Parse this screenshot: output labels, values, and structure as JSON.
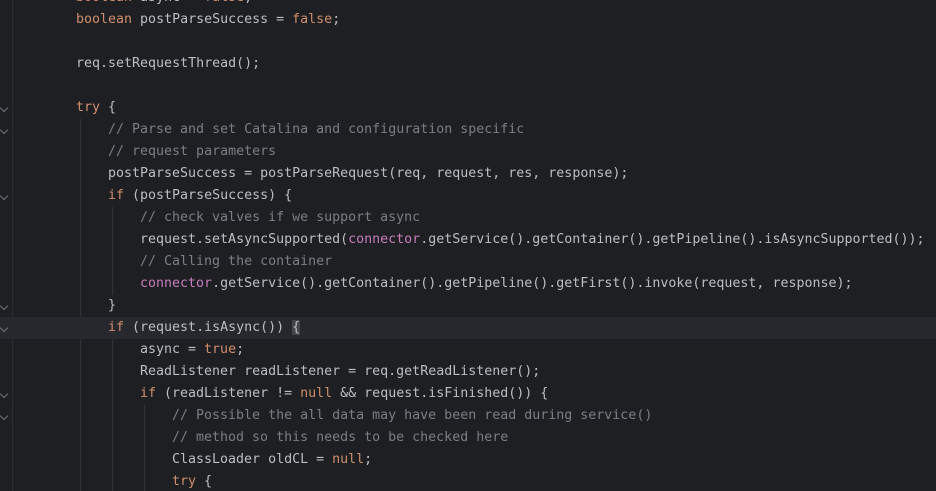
{
  "editor": {
    "lines": [
      {
        "indent": 0,
        "fold": false,
        "current": false,
        "tokens": [
          {
            "t": "kw",
            "v": "boolean"
          },
          {
            "t": "tx",
            "v": " async = "
          },
          {
            "t": "kw",
            "v": "false"
          },
          {
            "t": "tx",
            "v": ";"
          }
        ]
      },
      {
        "indent": 0,
        "fold": false,
        "current": false,
        "tokens": [
          {
            "t": "kw",
            "v": "boolean"
          },
          {
            "t": "tx",
            "v": " postParseSuccess = "
          },
          {
            "t": "kw",
            "v": "false"
          },
          {
            "t": "tx",
            "v": ";"
          }
        ]
      },
      {
        "indent": 0,
        "fold": false,
        "current": false,
        "tokens": []
      },
      {
        "indent": 0,
        "fold": false,
        "current": false,
        "tokens": [
          {
            "t": "tx",
            "v": "req.setRequestThread();"
          }
        ]
      },
      {
        "indent": 0,
        "fold": false,
        "current": false,
        "tokens": []
      },
      {
        "indent": 0,
        "fold": true,
        "current": false,
        "tokens": [
          {
            "t": "kw",
            "v": "try"
          },
          {
            "t": "tx",
            "v": " {"
          }
        ]
      },
      {
        "indent": 1,
        "fold": true,
        "current": false,
        "tokens": [
          {
            "t": "cm",
            "v": "// Parse and set Catalina and configuration specific"
          }
        ]
      },
      {
        "indent": 1,
        "fold": false,
        "current": false,
        "tokens": [
          {
            "t": "cm",
            "v": "// request parameters"
          }
        ]
      },
      {
        "indent": 1,
        "fold": false,
        "current": false,
        "tokens": [
          {
            "t": "tx",
            "v": "postParseSuccess = postParseRequest(req, request, res, response);"
          }
        ]
      },
      {
        "indent": 1,
        "fold": true,
        "current": false,
        "tokens": [
          {
            "t": "kw",
            "v": "if"
          },
          {
            "t": "tx",
            "v": " (postParseSuccess) {"
          }
        ]
      },
      {
        "indent": 2,
        "fold": false,
        "current": false,
        "tokens": [
          {
            "t": "cm",
            "v": "// check valves if we support async"
          }
        ]
      },
      {
        "indent": 2,
        "fold": false,
        "current": false,
        "tokens": [
          {
            "t": "tx",
            "v": "request.setAsyncSupported("
          },
          {
            "t": "fld",
            "v": "connector"
          },
          {
            "t": "tx",
            "v": ".getService().getContainer().getPipeline().isAsyncSupported());"
          }
        ]
      },
      {
        "indent": 2,
        "fold": false,
        "current": false,
        "tokens": [
          {
            "t": "cm",
            "v": "// Calling the container"
          }
        ]
      },
      {
        "indent": 2,
        "fold": false,
        "current": false,
        "tokens": [
          {
            "t": "fld",
            "v": "connector"
          },
          {
            "t": "tx",
            "v": ".getService().getContainer().getPipeline().getFirst().invoke(request, response);"
          }
        ]
      },
      {
        "indent": 1,
        "fold": true,
        "current": false,
        "tokens": [
          {
            "t": "tx",
            "v": "}"
          }
        ]
      },
      {
        "indent": 1,
        "fold": true,
        "current": true,
        "tokens": [
          {
            "t": "kw",
            "v": "if"
          },
          {
            "t": "tx",
            "v": " (request.isAsync()) "
          },
          {
            "t": "hl",
            "v": "{"
          }
        ]
      },
      {
        "indent": 2,
        "fold": false,
        "current": false,
        "tokens": [
          {
            "t": "tx",
            "v": "async = "
          },
          {
            "t": "kw",
            "v": "true"
          },
          {
            "t": "tx",
            "v": ";"
          }
        ]
      },
      {
        "indent": 2,
        "fold": false,
        "current": false,
        "tokens": [
          {
            "t": "tx",
            "v": "ReadListener readListener = req.getReadListener();"
          }
        ]
      },
      {
        "indent": 2,
        "fold": true,
        "current": false,
        "tokens": [
          {
            "t": "kw",
            "v": "if"
          },
          {
            "t": "tx",
            "v": " (readListener != "
          },
          {
            "t": "kw",
            "v": "null"
          },
          {
            "t": "tx",
            "v": " && request.isFinished()) {"
          }
        ]
      },
      {
        "indent": 3,
        "fold": true,
        "current": false,
        "tokens": [
          {
            "t": "cm",
            "v": "// Possible the all data may have been read during service()"
          }
        ]
      },
      {
        "indent": 3,
        "fold": false,
        "current": false,
        "tokens": [
          {
            "t": "cm",
            "v": "// method so this needs to be checked here"
          }
        ]
      },
      {
        "indent": 3,
        "fold": false,
        "current": false,
        "tokens": [
          {
            "t": "tx",
            "v": "ClassLoader oldCL = "
          },
          {
            "t": "kw",
            "v": "null"
          },
          {
            "t": "tx",
            "v": ";"
          }
        ]
      },
      {
        "indent": 3,
        "fold": false,
        "current": false,
        "tokens": [
          {
            "t": "kw",
            "v": "try"
          },
          {
            "t": "tx",
            "v": " {"
          }
        ]
      }
    ]
  }
}
